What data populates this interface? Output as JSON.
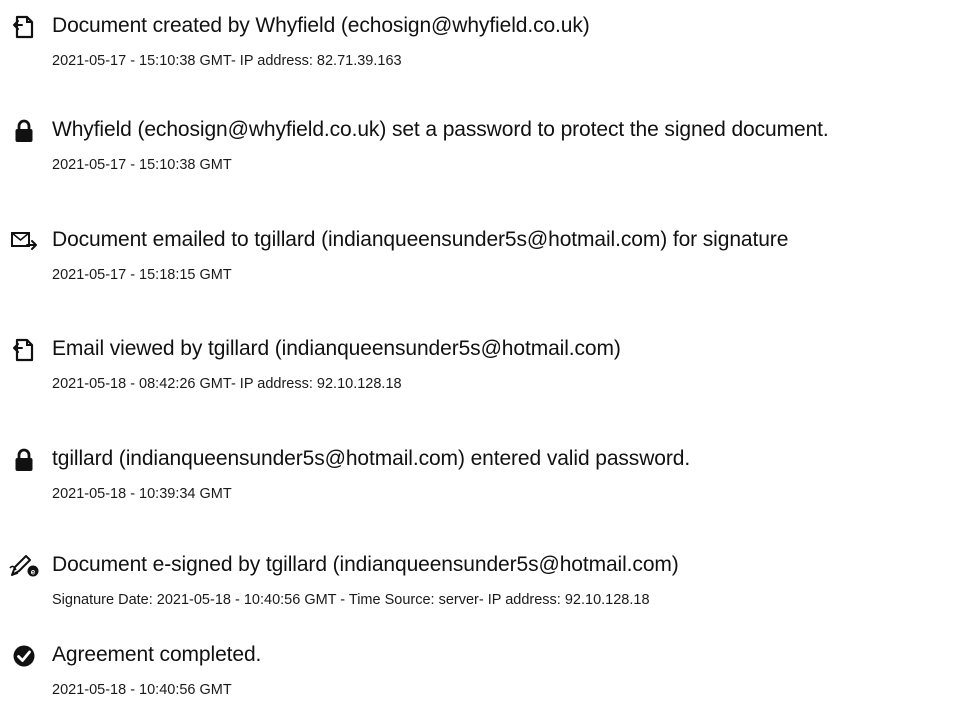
{
  "events": [
    {
      "icon": "document-created-icon",
      "description": "Document created by Whyfield (echosign@whyfield.co.uk)",
      "details": "2021-05-17 - 15:10:38 GMT- IP address: 82.71.39.163"
    },
    {
      "icon": "lock-icon",
      "description": "Whyfield (echosign@whyfield.co.uk) set a password to protect the signed document.",
      "details": "2021-05-17 - 15:10:38 GMT"
    },
    {
      "icon": "email-sent-icon",
      "description": "Document emailed to tgillard (indianqueensunder5s@hotmail.com) for signature",
      "details": "2021-05-17 - 15:18:15 GMT"
    },
    {
      "icon": "document-viewed-icon",
      "description": "Email viewed by tgillard (indianqueensunder5s@hotmail.com)",
      "details": "2021-05-18 - 08:42:26 GMT- IP address: 92.10.128.18"
    },
    {
      "icon": "lock-icon",
      "description": "tgillard (indianqueensunder5s@hotmail.com) entered valid password.",
      "details": "2021-05-18 - 10:39:34 GMT"
    },
    {
      "icon": "e-sign-pen-icon",
      "description": "Document e-signed by tgillard (indianqueensunder5s@hotmail.com)",
      "details": "Signature Date: 2021-05-18 - 10:40:56 GMT - Time Source: server- IP address: 92.10.128.18"
    },
    {
      "icon": "check-circle-icon",
      "description": "Agreement completed.",
      "details": "2021-05-18 - 10:40:56 GMT"
    }
  ]
}
